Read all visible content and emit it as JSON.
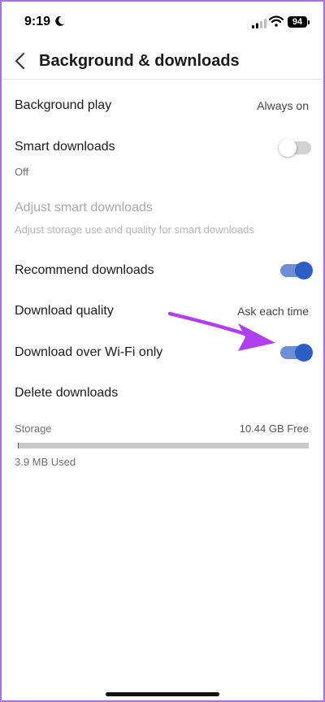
{
  "status_bar": {
    "time": "9:19",
    "battery": "94"
  },
  "header": {
    "title": "Background & downloads"
  },
  "settings": {
    "background_play": {
      "label": "Background play",
      "value": "Always on"
    },
    "smart_downloads": {
      "label": "Smart downloads",
      "sub": "Off",
      "toggle_on": false
    },
    "adjust_smart_downloads": {
      "label": "Adjust smart downloads",
      "sub": "Adjust storage use and quality for smart downloads",
      "enabled": false
    },
    "recommend_downloads": {
      "label": "Recommend downloads",
      "toggle_on": true
    },
    "download_quality": {
      "label": "Download quality",
      "value": "Ask each time"
    },
    "download_over_wifi": {
      "label": "Download over Wi-Fi only",
      "toggle_on": true
    },
    "delete_downloads": {
      "label": "Delete downloads"
    }
  },
  "storage": {
    "label": "Storage",
    "free": "10.44 GB Free",
    "used": "3.9 MB Used",
    "used_fraction": 0.0004
  },
  "colors": {
    "accent": "#2d5dc6",
    "toggle_track_on": "#6c8fd6",
    "annotation_arrow": "#b03ff0",
    "frame": "#ab6fe3"
  },
  "icons": {
    "back": "chevron-left-icon",
    "moon": "moon-icon",
    "signal": "cellular-signal-icon",
    "wifi": "wifi-icon",
    "battery": "battery-icon"
  }
}
